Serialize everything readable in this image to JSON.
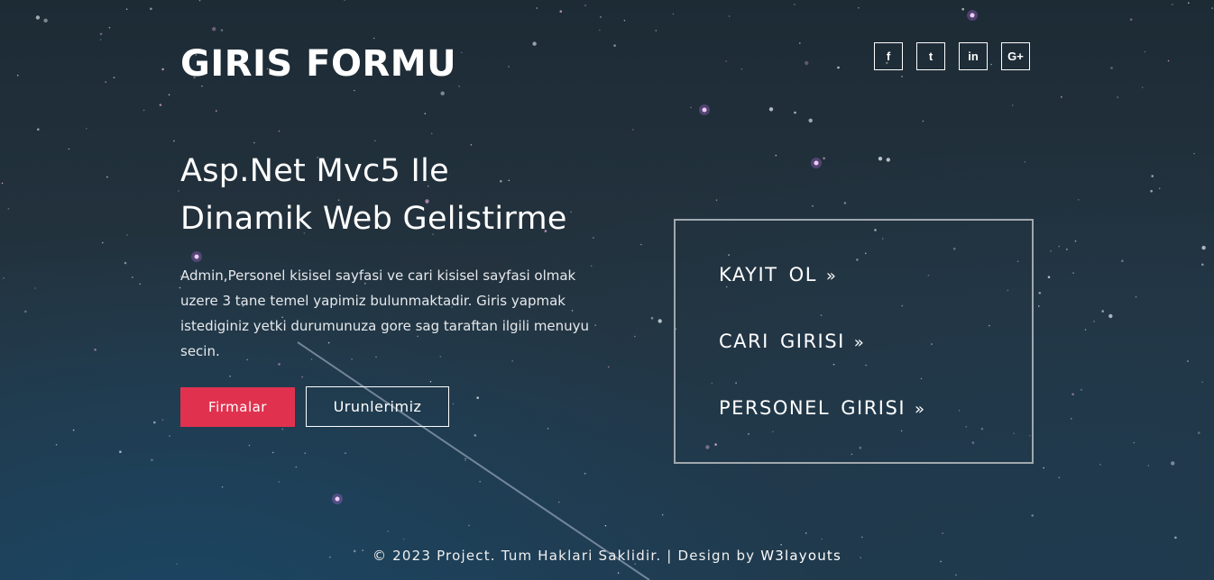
{
  "header": {
    "brand": "GIRIS FORMU",
    "social": [
      {
        "icon": "facebook-icon",
        "glyph": "f"
      },
      {
        "icon": "twitter-icon",
        "glyph": "t"
      },
      {
        "icon": "linkedin-icon",
        "glyph": "in"
      },
      {
        "icon": "google-plus-icon",
        "glyph": "G+"
      }
    ]
  },
  "hero": {
    "headline_line1": "Asp.Net Mvc5 Ile",
    "headline_line2": "Dinamik Web Gelistirme",
    "description": "Admin,Personel kisisel sayfasi ve cari kisisel sayfasi olmak uzere 3 tane temel yapimiz bulunmaktadir. Giris yapmak istediginiz yetki durumunuza gore sag taraftan ilgili menuyu secin.",
    "primary_button": "Firmalar",
    "secondary_button": "Urunlerimiz"
  },
  "login_menu": {
    "items": [
      {
        "label": "KAYIT OL",
        "chevron": "»"
      },
      {
        "label": "CARI GIRISI",
        "chevron": "»"
      },
      {
        "label": "PERSONEL GIRISI",
        "chevron": "»"
      }
    ]
  },
  "footer": {
    "text": "© 2023 Project. Tum Haklari Saklidir. | Design by ",
    "link": "W3layouts"
  },
  "colors": {
    "accent": "#e0324f",
    "background": "#243440"
  }
}
